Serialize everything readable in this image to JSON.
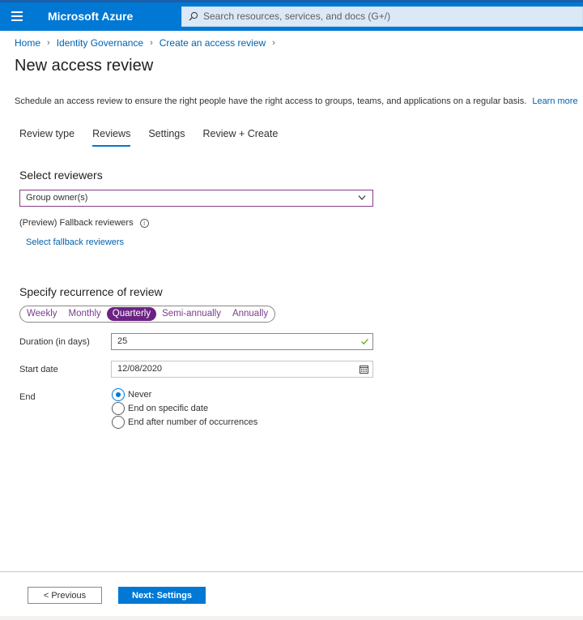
{
  "header": {
    "brand": "Microsoft Azure",
    "search_placeholder": "Search resources, services, and docs (G+/)"
  },
  "breadcrumb": [
    "Home",
    "Identity Governance",
    "Create an access review"
  ],
  "page_title": "New access review",
  "description": "Schedule an access review to ensure the right people have the right access to groups, teams, and applications on a regular basis.",
  "learn_more": "Learn more",
  "tabs": [
    {
      "label": "Review type",
      "active": false
    },
    {
      "label": "Reviews",
      "active": true
    },
    {
      "label": "Settings",
      "active": false
    },
    {
      "label": "Review + Create",
      "active": false
    }
  ],
  "reviewers": {
    "title": "Select reviewers",
    "selected": "Group owner(s)",
    "fallback_label": "(Preview) Fallback reviewers",
    "fallback_link": "Select fallback reviewers"
  },
  "recurrence": {
    "title": "Specify recurrence of review",
    "options": [
      "Weekly",
      "Monthly",
      "Quarterly",
      "Semi-annually",
      "Annually"
    ],
    "selected": "Quarterly",
    "duration_label": "Duration (in days)",
    "duration_value": "25",
    "start_label": "Start date",
    "start_value": "12/08/2020",
    "end_label": "End",
    "end_options": [
      "Never",
      "End on specific date",
      "End after number of occurrences"
    ],
    "end_selected": "Never"
  },
  "footer": {
    "previous": "< Previous",
    "next": "Next: Settings"
  },
  "colors": {
    "accent": "#0078d4",
    "pill_selected": "#6b2383"
  }
}
